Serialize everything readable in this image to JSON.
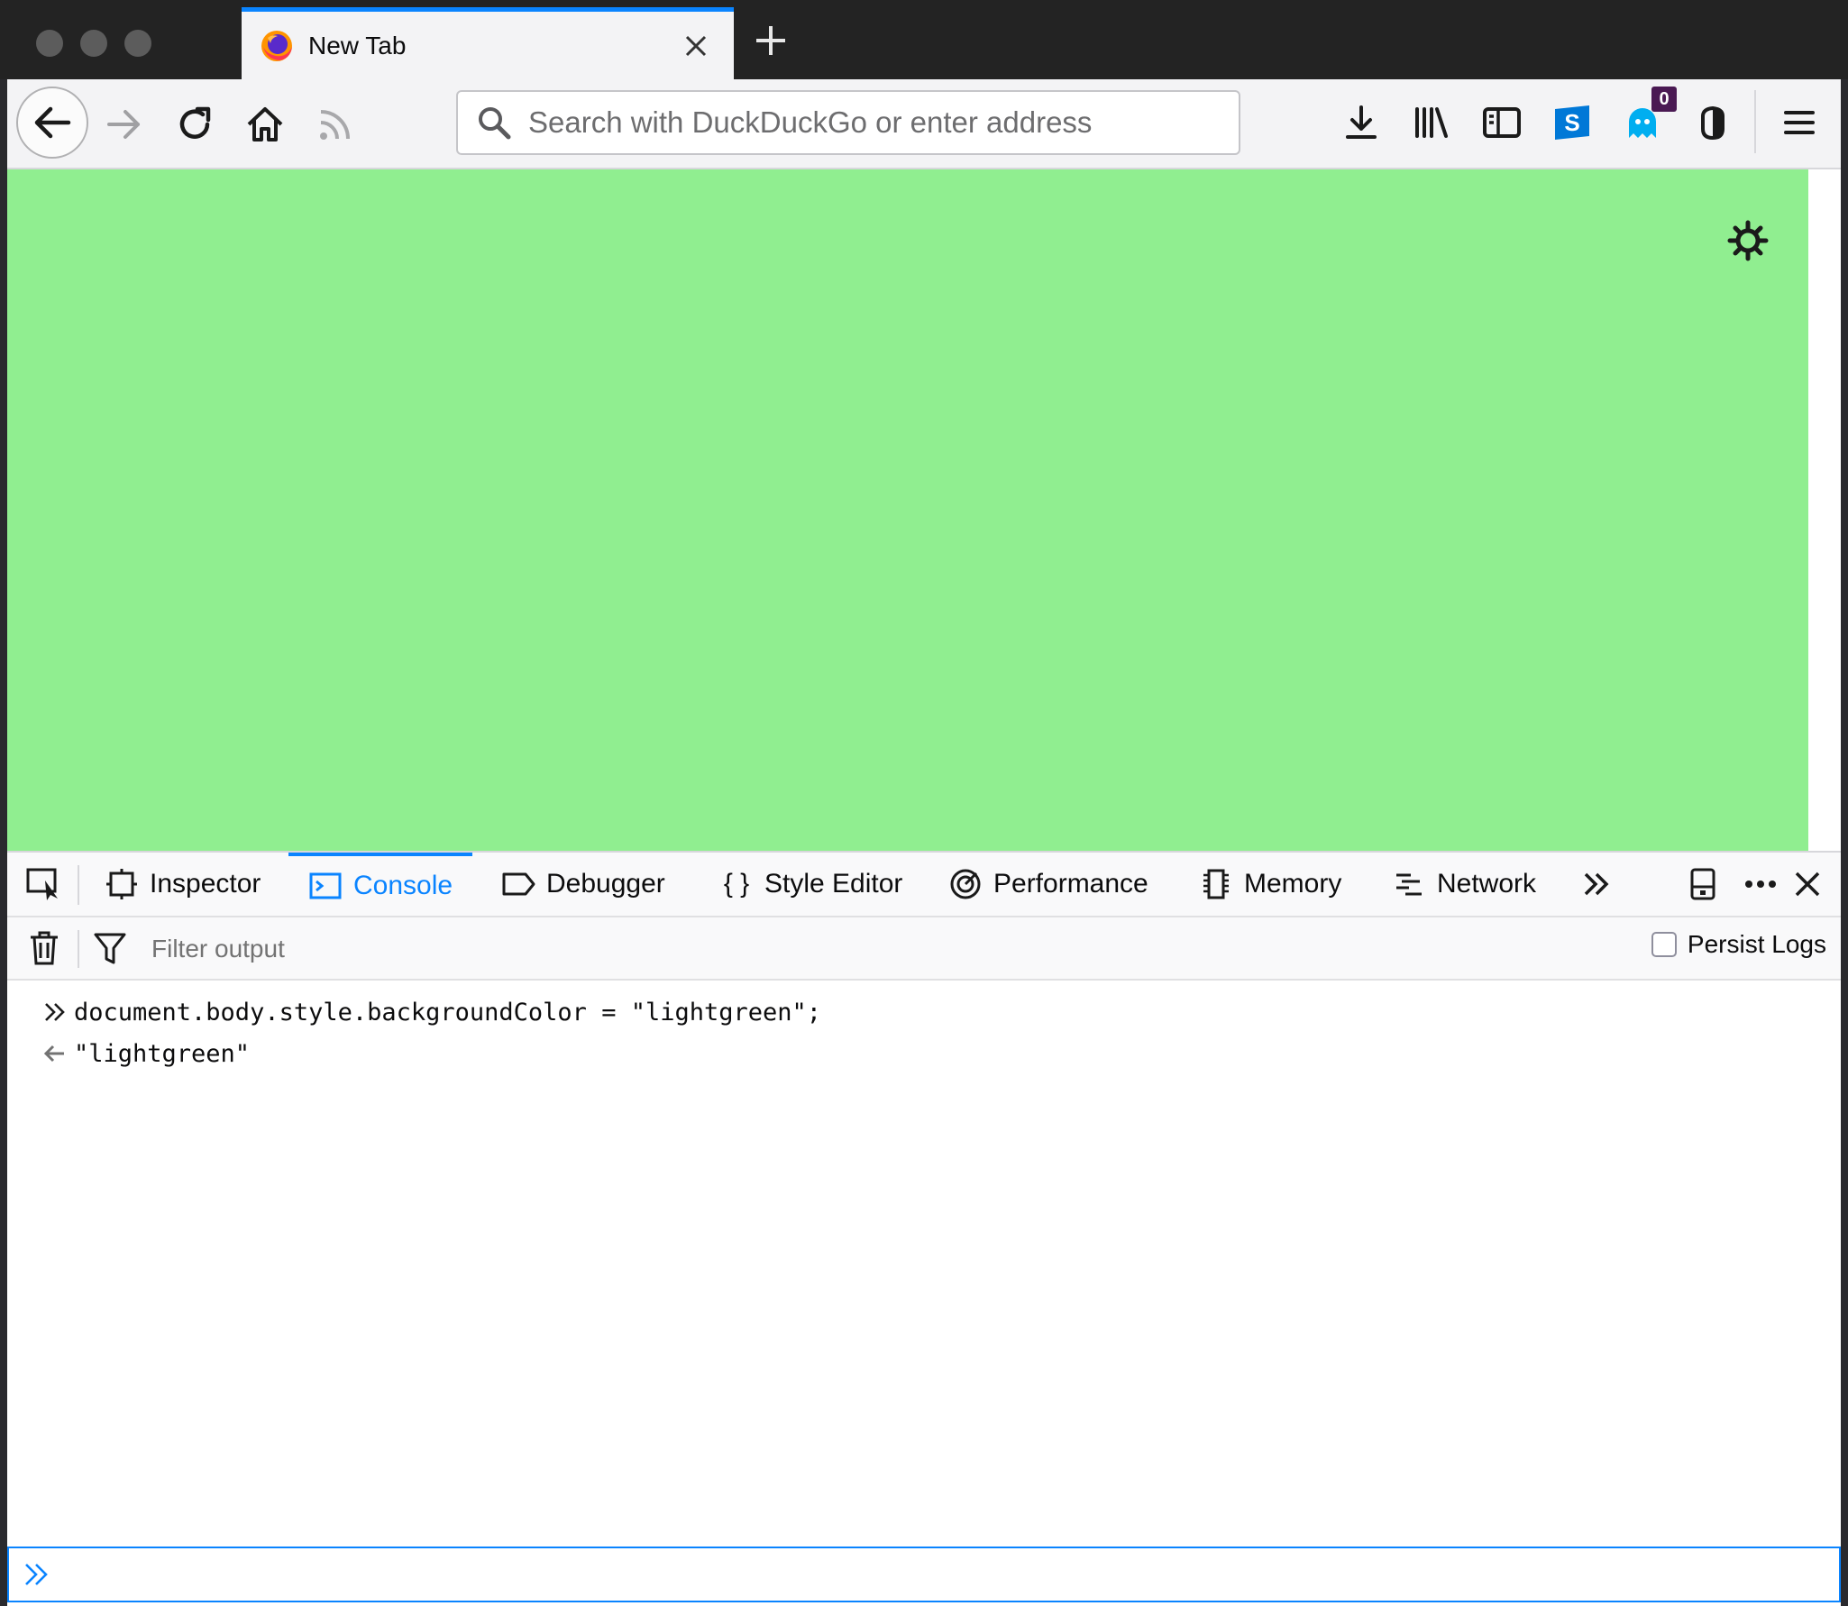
{
  "tab": {
    "title": "New Tab"
  },
  "urlbar": {
    "placeholder": "Search with DuckDuckGo or enter address"
  },
  "toolbar": {
    "notification_count": "0"
  },
  "page": {
    "background_color": "#90ee90"
  },
  "devtools": {
    "tabs": [
      {
        "label": "Inspector",
        "icon": "inspector-icon"
      },
      {
        "label": "Console",
        "icon": "console-icon",
        "selected": true
      },
      {
        "label": "Debugger",
        "icon": "debugger-icon"
      },
      {
        "label": "Style Editor",
        "icon": "style-editor-icon"
      },
      {
        "label": "Performance",
        "icon": "performance-icon"
      },
      {
        "label": "Memory",
        "icon": "memory-icon"
      },
      {
        "label": "Network",
        "icon": "network-icon"
      }
    ],
    "filter_placeholder": "Filter output",
    "persist_logs_label": "Persist Logs",
    "console": {
      "input_line": "document.body.style.backgroundColor = \"lightgreen\";",
      "result_line": "\"lightgreen\""
    }
  },
  "colors": {
    "accent": "#0a84ff",
    "tabstrip": "#232323",
    "toolbar": "#f3f3f5"
  }
}
